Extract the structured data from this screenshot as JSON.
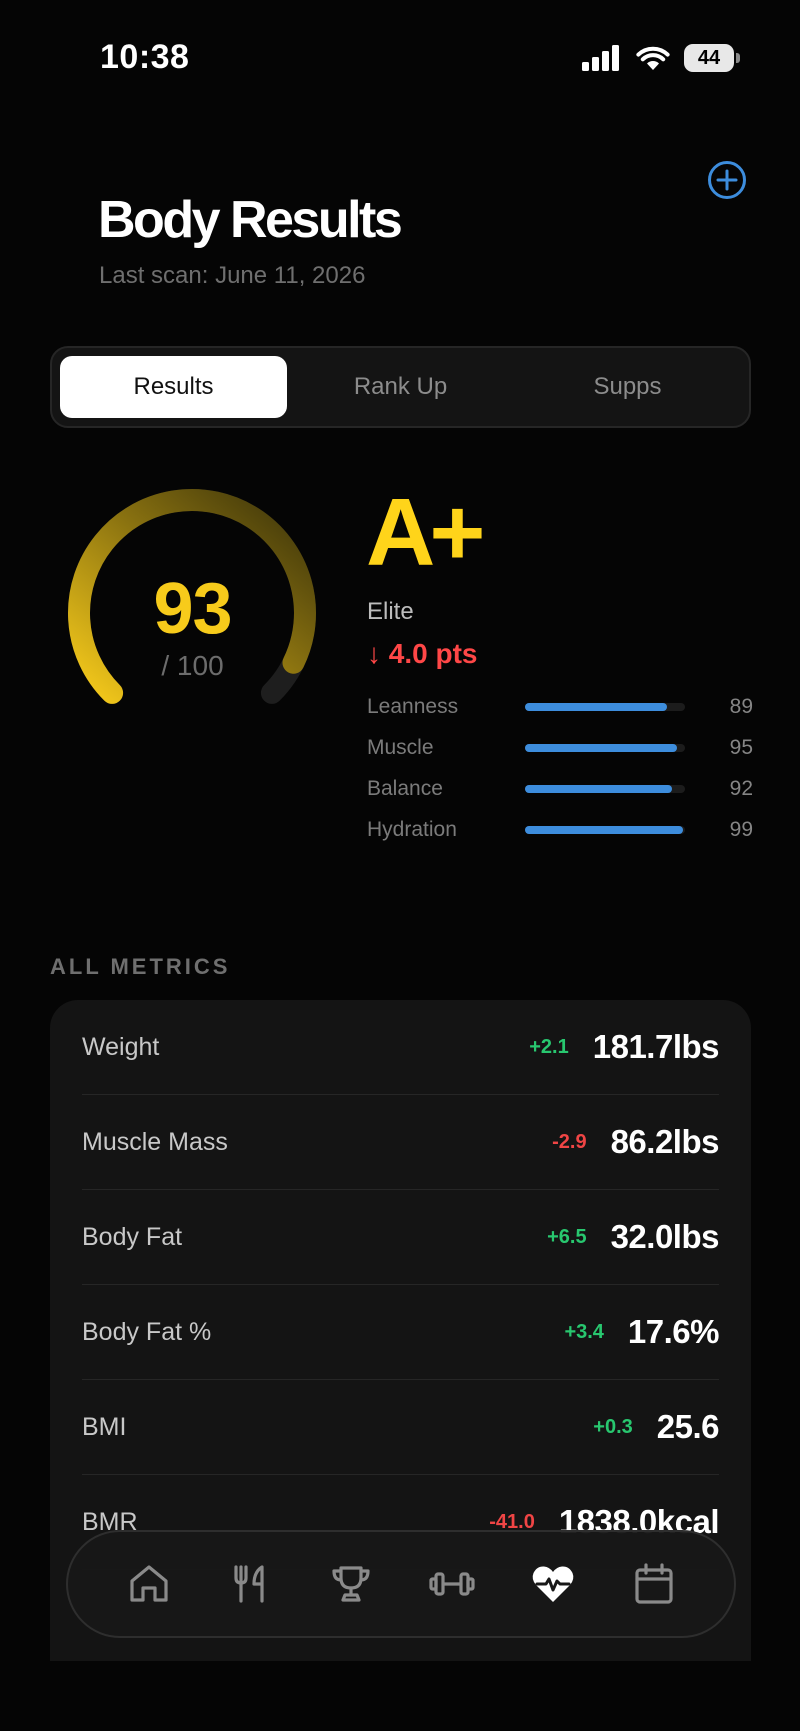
{
  "status_bar": {
    "time": "10:38",
    "battery": "44"
  },
  "header": {
    "title": "Body Results",
    "subtitle": "Last scan: June 11, 2026"
  },
  "tabs": [
    {
      "label": "Results",
      "active": true
    },
    {
      "label": "Rank Up",
      "active": false
    },
    {
      "label": "Supps",
      "active": false
    }
  ],
  "score": {
    "value": "93",
    "max": "/ 100",
    "fraction": 0.93,
    "grade": "A+",
    "tier": "Elite",
    "delta": "↓ 4.0 pts",
    "gauge_color": "#f7cb1b"
  },
  "sub_scores": [
    {
      "label": "Leanness",
      "value": "89",
      "fill": 0.89
    },
    {
      "label": "Muscle",
      "value": "95",
      "fill": 0.95
    },
    {
      "label": "Balance",
      "value": "92",
      "fill": 0.92
    },
    {
      "label": "Hydration",
      "value": "99",
      "fill": 0.99
    }
  ],
  "metrics_section": {
    "label": "ALL METRICS",
    "rows": [
      {
        "name": "Weight",
        "delta": "+2.1",
        "dir": "up",
        "value": "181.7lbs"
      },
      {
        "name": "Muscle Mass",
        "delta": "-2.9",
        "dir": "down",
        "value": "86.2lbs"
      },
      {
        "name": "Body Fat",
        "delta": "+6.5",
        "dir": "up",
        "value": "32.0lbs"
      },
      {
        "name": "Body Fat %",
        "delta": "+3.4",
        "dir": "up",
        "value": "17.6%"
      },
      {
        "name": "BMI",
        "delta": "+0.3",
        "dir": "up",
        "value": "25.6"
      },
      {
        "name": "BMR",
        "delta": "-41.0",
        "dir": "down",
        "value": "1838.0kcal"
      }
    ]
  },
  "colors": {
    "accent": "#f7cb1b",
    "bar": "#3d8ddd",
    "positive": "#28c76f",
    "negative": "#f04545",
    "add": "#3d8ddd"
  },
  "tab_bar": [
    {
      "icon": "home-icon",
      "active": false
    },
    {
      "icon": "fork-knife-icon",
      "active": false
    },
    {
      "icon": "trophy-icon",
      "active": false
    },
    {
      "icon": "dumbbell-icon",
      "active": false
    },
    {
      "icon": "heart-pulse-icon",
      "active": true
    },
    {
      "icon": "calendar-icon",
      "active": false
    }
  ]
}
